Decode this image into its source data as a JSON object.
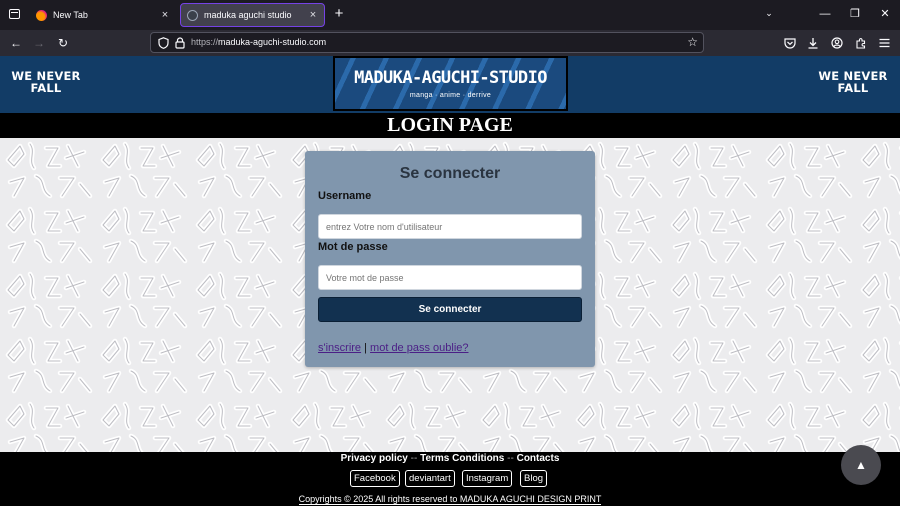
{
  "browser": {
    "tabs": [
      {
        "title": "New Tab",
        "close": "×"
      },
      {
        "title": "maduka aguchi studio",
        "close": "×"
      }
    ],
    "new_tab_glyph": "+",
    "tabs_list_glyph": "⌄",
    "window": {
      "minimize": "—",
      "restore": "❐",
      "close": "✕"
    },
    "nav": {
      "back": "←",
      "forward": "→",
      "reload": "↻"
    },
    "url": {
      "scheme": "https://",
      "host": "maduka-aguchi-studio.com"
    },
    "icons": [
      "shield-icon",
      "lock-icon",
      "star-icon",
      "pocket-icon",
      "download-icon",
      "account-icon",
      "extensions-icon",
      "menu-icon"
    ]
  },
  "header": {
    "slogan_left": "WE NEVER FALL",
    "slogan_right": "WE NEVER FALL",
    "logo_title": "MADUKA-AGUCHI-STUDIO",
    "logo_subtitle": "manga · anime · derrive"
  },
  "page_title": "LOGIN PAGE",
  "login": {
    "heading": "Se connecter",
    "username_label": "Username",
    "username_placeholder": "entrez Votre nom d'utilisateur",
    "password_label": "Mot de passe",
    "password_placeholder": "Votre mot de passe",
    "submit_label": "Se connecter",
    "register_link": "s'inscrire",
    "link_separator": "|",
    "forgot_link": "mot de pass oublie?"
  },
  "footer": {
    "privacy": "Privacy policy",
    "terms": "Terms Conditions",
    "contacts": "Contacts",
    "separator": "--",
    "social": [
      "Facebook",
      "deviantart",
      "Instagram",
      "Blog"
    ],
    "copyright": "Copyrights © 2025 All rights reserved to MADUKA AGUCHI DESIGN PRINT"
  },
  "scroll_top_glyph": "▲",
  "colors": {
    "header_bg": "#123c66",
    "card_bg": "#8096ad",
    "button_bg": "#123150",
    "link": "#4b1f86",
    "tab_accent": "#7542e5"
  }
}
